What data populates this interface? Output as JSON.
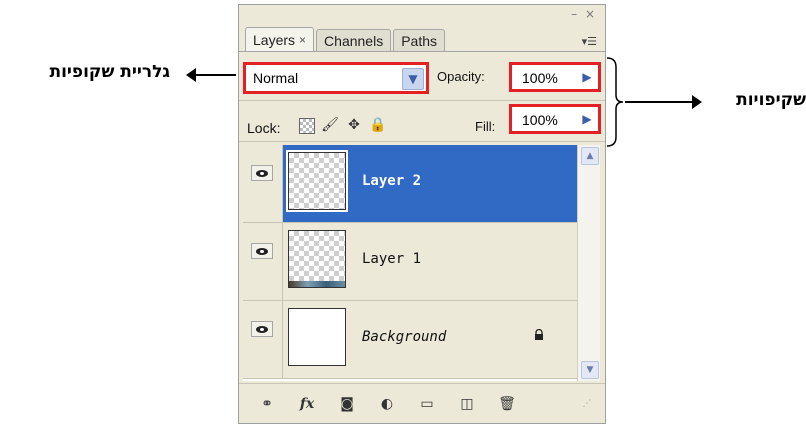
{
  "annotations": {
    "left_label": "גלריית שקופיות",
    "right_label": "שקיפויות"
  },
  "panel": {
    "window_controls": "– ×",
    "tabs": [
      {
        "label": "Layers",
        "close": "×",
        "active": true
      },
      {
        "label": "Channels",
        "active": false
      },
      {
        "label": "Paths",
        "active": false
      }
    ],
    "blend_mode": "Normal",
    "opacity_label": "Opacity:",
    "opacity_value": "100%",
    "lock_label": "Lock:",
    "fill_label": "Fill:",
    "fill_value": "100%",
    "layers": [
      {
        "name": "Layer 2",
        "selected": true,
        "visible": true
      },
      {
        "name": "Layer 1",
        "selected": false,
        "visible": true
      },
      {
        "name": "Background",
        "selected": false,
        "visible": true,
        "locked": true
      }
    ],
    "toolbar_icons": [
      "link-icon",
      "fx-icon",
      "mask-icon",
      "adjustment-icon",
      "folder-icon",
      "new-layer-icon",
      "trash-icon"
    ]
  },
  "colors": {
    "highlight": "#e32024",
    "selection": "#316ac5"
  }
}
